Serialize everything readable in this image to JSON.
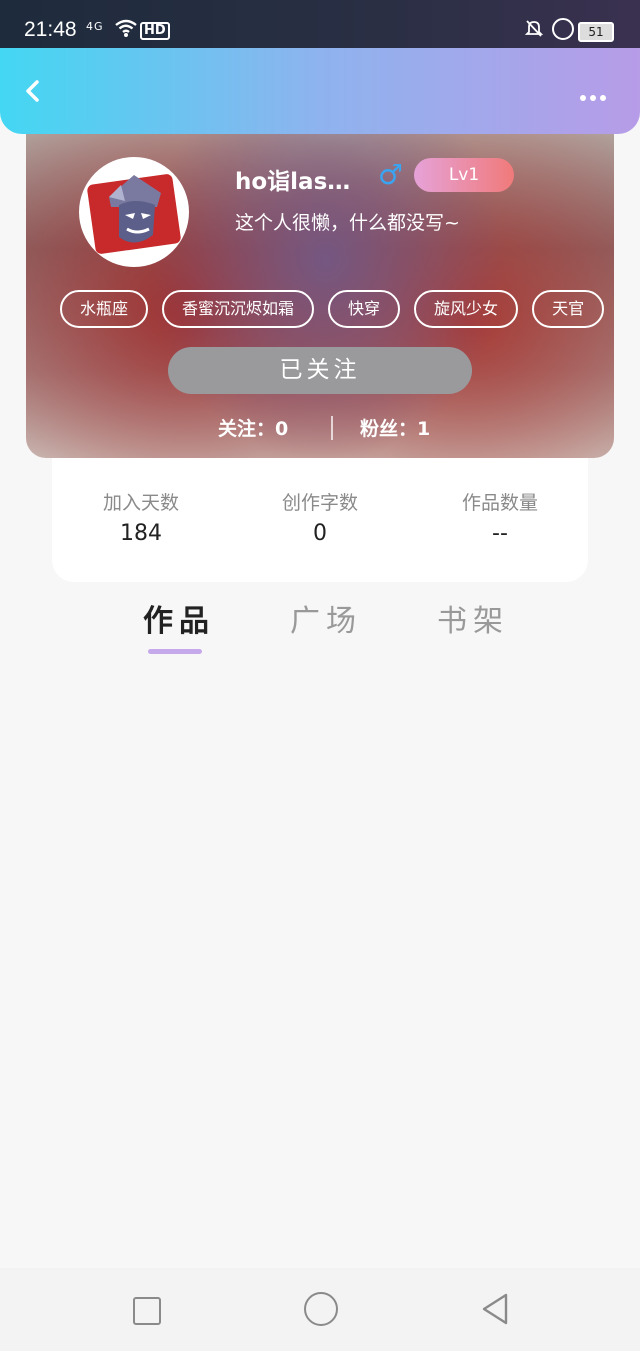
{
  "status_bar": {
    "time": "21:48",
    "signal_label": "4G",
    "hd_label": "HD",
    "battery": "51"
  },
  "header": {
    "back_icon": "chevron-left-icon",
    "more_icon": "more-horizontal-icon"
  },
  "profile": {
    "username": "ho诣las…",
    "gender_symbol": "♂",
    "level": "Lv1",
    "bio": "这个人很懒，什么都没写~",
    "tags": [
      "水瓶座",
      "香蜜沉沉烬如霜",
      "快穿",
      "旋风少女",
      "天官"
    ],
    "follow_button": "已关注",
    "following": "关注：0",
    "fans": "粉丝：1"
  },
  "stats": [
    {
      "label": "加入天数",
      "value": "184"
    },
    {
      "label": "创作字数",
      "value": "0"
    },
    {
      "label": "作品数量",
      "value": "--"
    }
  ],
  "tabs": [
    {
      "label": "作品",
      "active": true
    },
    {
      "label": "广场",
      "active": false
    },
    {
      "label": "书架",
      "active": false
    }
  ],
  "colors": {
    "header_gradient_start": "#43d7f3",
    "header_gradient_end": "#b79ce8",
    "tab_indicator": "#c5a9ea",
    "level_badge_start": "#e6a2d8",
    "level_badge_end": "#f07a7a",
    "gender_icon": "#3aa4f0"
  }
}
